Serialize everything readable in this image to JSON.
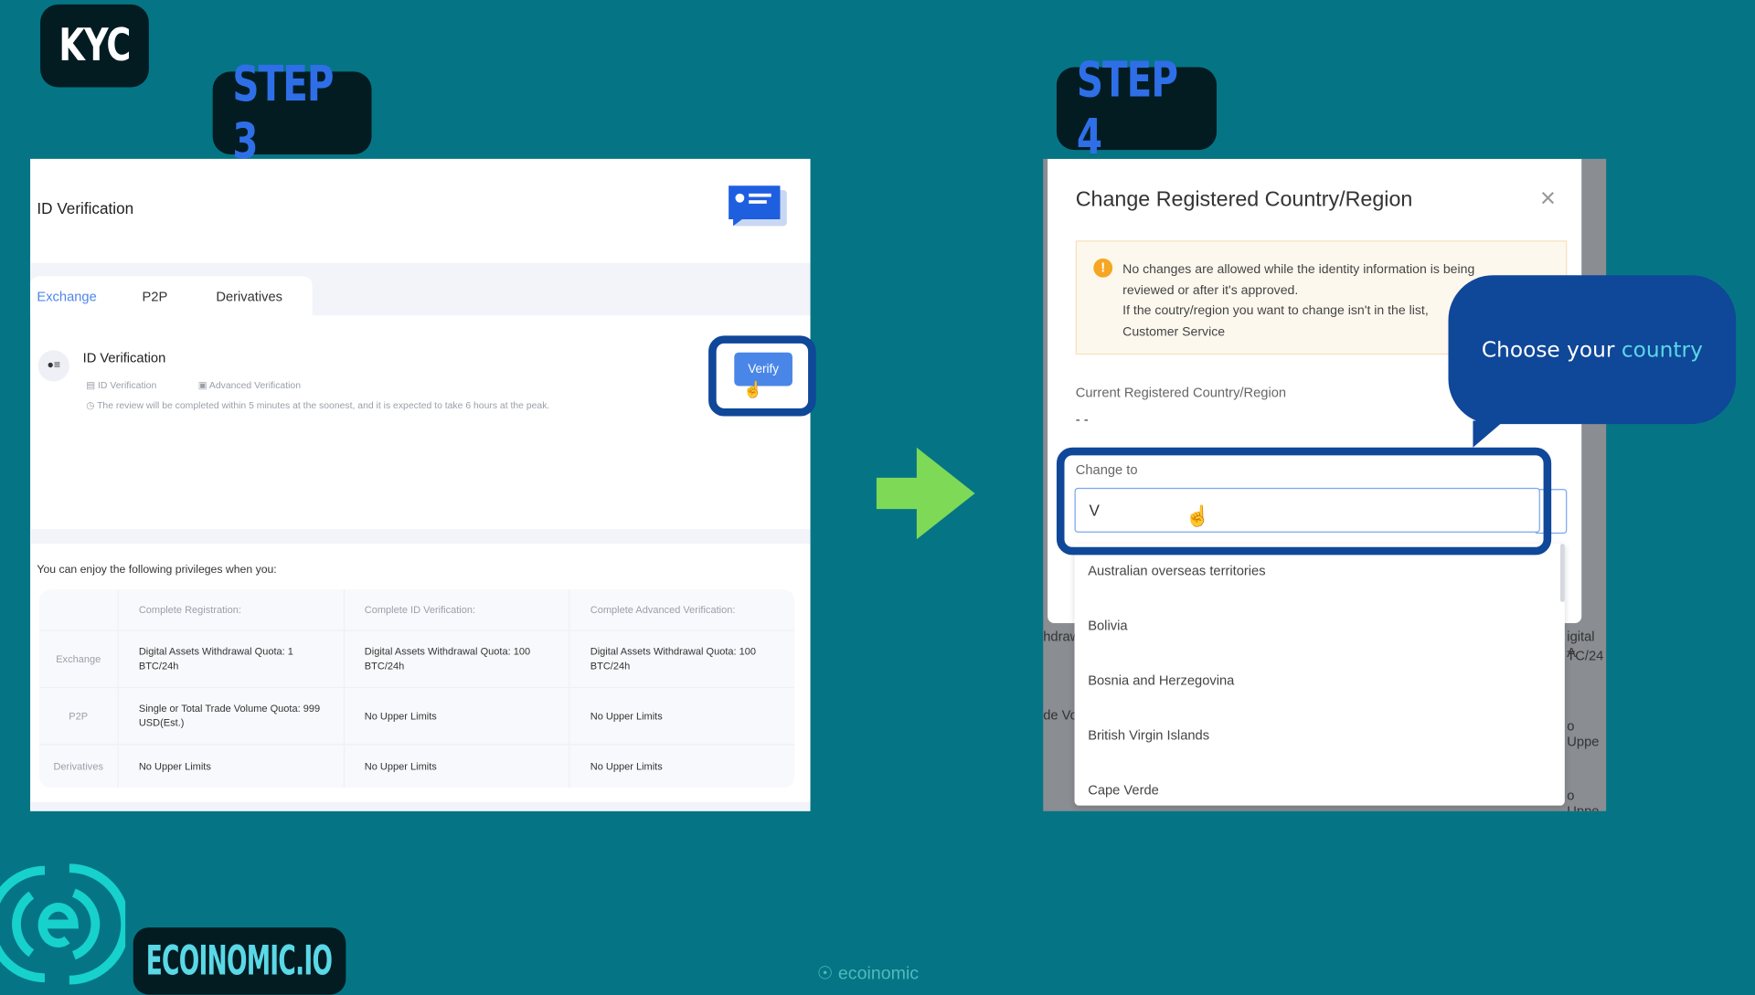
{
  "header": {
    "kyc_label": "KYC",
    "step3_label": "STEP 3",
    "step4_label": "STEP 4"
  },
  "colors": {
    "background": "#057585",
    "badge": "#021c22",
    "step_text": "#2e6fe8",
    "highlight": "#0f4799",
    "arrow": "#7ed957",
    "accent_link": "#4f86e8"
  },
  "step3": {
    "page_title": "ID Verification",
    "tabs": [
      {
        "label": "Exchange",
        "active": true
      },
      {
        "label": "P2P"
      },
      {
        "label": "Derivatives"
      }
    ],
    "verification": {
      "title": "ID Verification",
      "sub_items": [
        "ID Verification",
        "Advanced Verification"
      ],
      "note": "The review will be completed within 5 minutes at the soonest, and it is expected to take 6 hours at the peak.",
      "verify_button": "Verify"
    },
    "privileges_intro": "You can enjoy the following privileges when you:",
    "table": {
      "headers": [
        "",
        "Complete Registration:",
        "Complete ID Verification:",
        "Complete Advanced Verification:"
      ],
      "rows": [
        [
          "Exchange",
          "Digital Assets Withdrawal Quota: 1 BTC/24h",
          "Digital Assets Withdrawal Quota: 100 BTC/24h",
          "Digital Assets Withdrawal Quota: 100 BTC/24h"
        ],
        [
          "P2P",
          "Single or Total Trade Volume Quota: 999 USD(Est.)",
          "No Upper Limits",
          "No Upper Limits"
        ],
        [
          "Derivatives",
          "No Upper Limits",
          "No Upper Limits",
          "No Upper Limits"
        ]
      ]
    }
  },
  "step4": {
    "dialog_title": "Change Registered Country/Region",
    "warning_lines": [
      "No changes are allowed while the identity information is being",
      "reviewed or after it's approved.",
      "If the coutry/region you want to change isn't in the list,",
      "Customer Service"
    ],
    "current_label": "Current Registered Country/Region",
    "current_value": "- -",
    "change_label": "Change to",
    "input_value": "V",
    "options": [
      "Australian overseas territories",
      "Bolivia",
      "Bosnia and Herzegovina",
      "British Virgin Islands",
      "Cape Verde"
    ],
    "background_fragments": [
      "hdraw",
      "de Vo",
      "igital A",
      "TC/24",
      "o Uppe",
      "o Uppe"
    ]
  },
  "callout": {
    "text_prefix": "Choose your ",
    "text_highlight": "country"
  },
  "branding": {
    "logo_text": "ECOINOMIC.IO",
    "watermark": "ecoinomic"
  }
}
